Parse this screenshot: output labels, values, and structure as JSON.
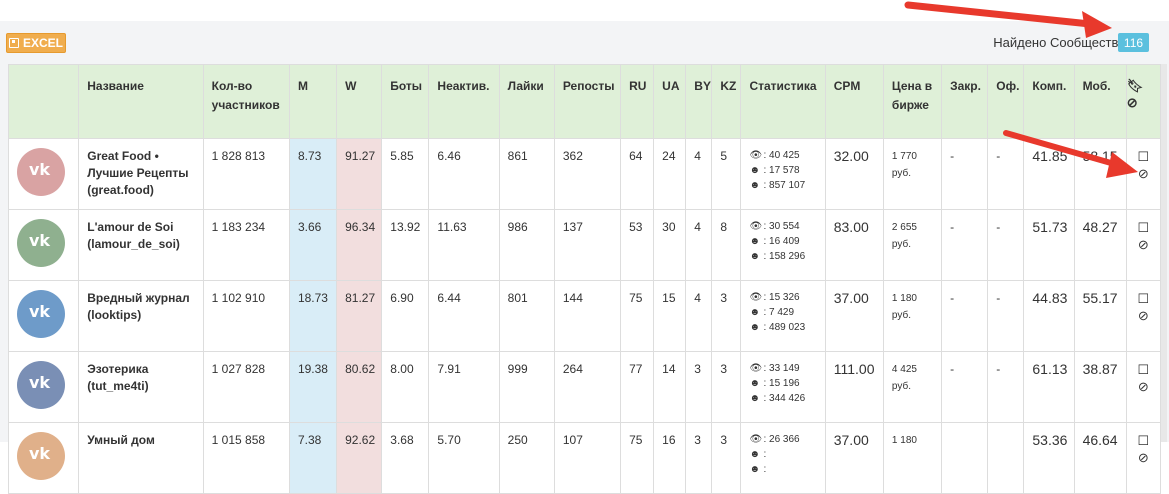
{
  "toolbar": {
    "excel_label": "EXCEL"
  },
  "found": {
    "label": "Найдено Сообществ:",
    "count": "116"
  },
  "headers": [
    "Название",
    "Кол-во участников",
    "M",
    "W",
    "Боты",
    "Неактив.",
    "Лайки",
    "Репосты",
    "RU",
    "UA",
    "BY",
    "KZ",
    "Статистика",
    "CPM",
    "Цена в бирже",
    "Закр.",
    "Оф.",
    "Комп.",
    "Моб."
  ],
  "rows": [
    {
      "name": "Great Food • Лучшие Рецепты (great.food)",
      "members": "1 828 813",
      "m": "8.73",
      "w": "91.27",
      "bots": "5.85",
      "inactive": "6.46",
      "likes": "861",
      "reposts": "362",
      "ru": "64",
      "ua": "24",
      "by": "4",
      "kz": "5",
      "stat_views": "40 425",
      "stat_users": "17 578",
      "stat_reach": "857 107",
      "cpm": "32.00",
      "price": "1 770",
      "price_unit": "руб.",
      "closed": "-",
      "official": "-",
      "comp": "41.85",
      "mob": "58.15"
    },
    {
      "name": "L'amour de Soi (lamour_de_soi)",
      "members": "1 183 234",
      "m": "3.66",
      "w": "96.34",
      "bots": "13.92",
      "inactive": "11.63",
      "likes": "986",
      "reposts": "137",
      "ru": "53",
      "ua": "30",
      "by": "4",
      "kz": "8",
      "stat_views": "30 554",
      "stat_users": "16 409",
      "stat_reach": "158 296",
      "cpm": "83.00",
      "price": "2 655",
      "price_unit": "руб.",
      "closed": "-",
      "official": "-",
      "comp": "51.73",
      "mob": "48.27"
    },
    {
      "name": "Вредный журнал (looktips)",
      "members": "1 102 910",
      "m": "18.73",
      "w": "81.27",
      "bots": "6.90",
      "inactive": "6.44",
      "likes": "801",
      "reposts": "144",
      "ru": "75",
      "ua": "15",
      "by": "4",
      "kz": "3",
      "stat_views": "15 326",
      "stat_users": "7 429",
      "stat_reach": "489 023",
      "cpm": "37.00",
      "price": "1 180",
      "price_unit": "руб.",
      "closed": "-",
      "official": "-",
      "comp": "44.83",
      "mob": "55.17"
    },
    {
      "name": "Эзотерика (tut_me4ti)",
      "members": "1 027 828",
      "m": "19.38",
      "w": "80.62",
      "bots": "8.00",
      "inactive": "7.91",
      "likes": "999",
      "reposts": "264",
      "ru": "77",
      "ua": "14",
      "by": "3",
      "kz": "3",
      "stat_views": "33 149",
      "stat_users": "15 196",
      "stat_reach": "344 426",
      "cpm": "111.00",
      "price": "4 425",
      "price_unit": "руб.",
      "closed": "-",
      "official": "-",
      "comp": "61.13",
      "mob": "38.87"
    },
    {
      "name": "Умный дом",
      "members": "1 015 858",
      "m": "7.38",
      "w": "92.62",
      "bots": "3.68",
      "inactive": "5.70",
      "likes": "250",
      "reposts": "107",
      "ru": "75",
      "ua": "16",
      "by": "3",
      "kz": "3",
      "stat_views": "26 366",
      "stat_users": "",
      "stat_reach": "",
      "cpm": "37.00",
      "price": "1 180",
      "price_unit": "",
      "closed": "",
      "official": "",
      "comp": "53.36",
      "mob": "46.64"
    }
  ],
  "colors": {
    "header_green": "#dff0d8",
    "m_blue": "#d9edf7",
    "w_red": "#f2dede",
    "excel_orange": "#f0ad4e",
    "badge_blue": "#5bc0de",
    "arrow_red": "#e8392c"
  },
  "icons": {
    "bookmark": "bookmark-icon",
    "ban": "ban-icon",
    "eye": "eye-icon",
    "user": "user-icon",
    "users": "users-icon",
    "save": "save-icon"
  }
}
